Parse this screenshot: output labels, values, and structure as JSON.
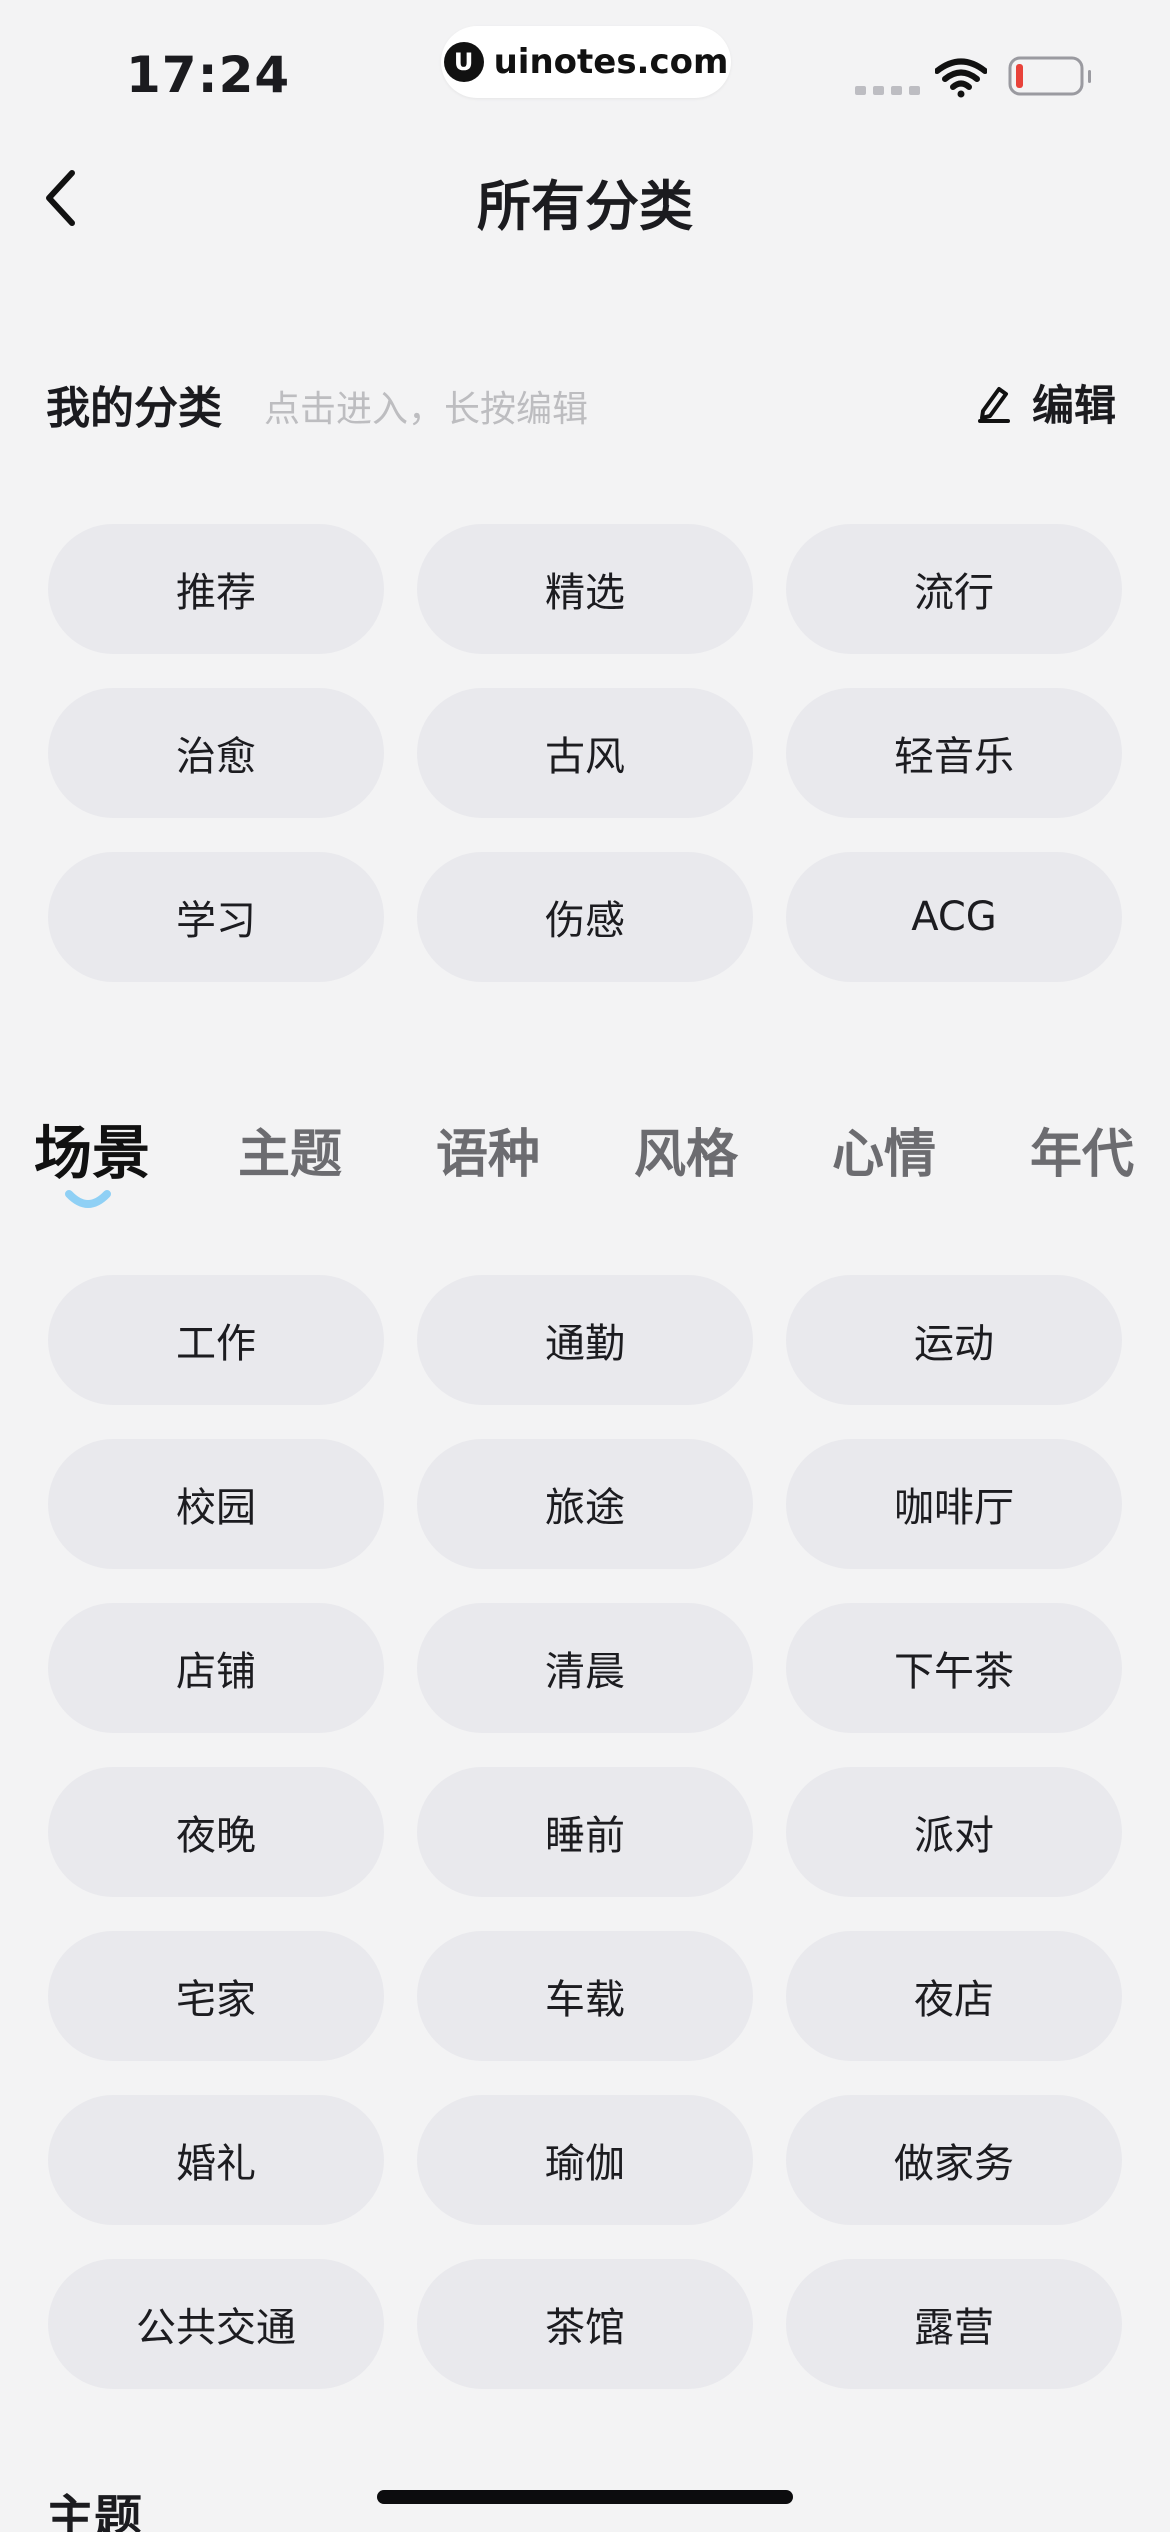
{
  "status_bar": {
    "time": "17:24",
    "url_logo": "U",
    "url": "uinotes.com",
    "icons": [
      "signal-icon",
      "wifi-icon",
      "battery-low-icon"
    ]
  },
  "nav": {
    "back_icon": "chevron-left-icon",
    "title": "所有分类"
  },
  "my_categories": {
    "title": "我的分类",
    "hint": "点击进入，长按编辑",
    "edit_icon": "pencil-icon",
    "edit_label": "编辑",
    "items": [
      "推荐",
      "精选",
      "流行",
      "治愈",
      "古风",
      "轻音乐",
      "学习",
      "伤感",
      "ACG"
    ]
  },
  "category_tabs": {
    "active_index": 0,
    "items": [
      "场景",
      "主题",
      "语种",
      "风格",
      "心情",
      "年代"
    ]
  },
  "scene": {
    "items": [
      "工作",
      "通勤",
      "运动",
      "校园",
      "旅途",
      "咖啡厅",
      "店铺",
      "清晨",
      "下午茶",
      "夜晚",
      "睡前",
      "派对",
      "宅家",
      "车载",
      "夜店",
      "婚礼",
      "瑜伽",
      "做家务",
      "公共交通",
      "茶馆",
      "露营"
    ]
  },
  "next_section_title": "主题",
  "colors": {
    "background": "#f3f3f4",
    "chip": "#e9e9ed",
    "tab_indicator": "#8fd0f5",
    "battery_low": "#e8423a"
  }
}
